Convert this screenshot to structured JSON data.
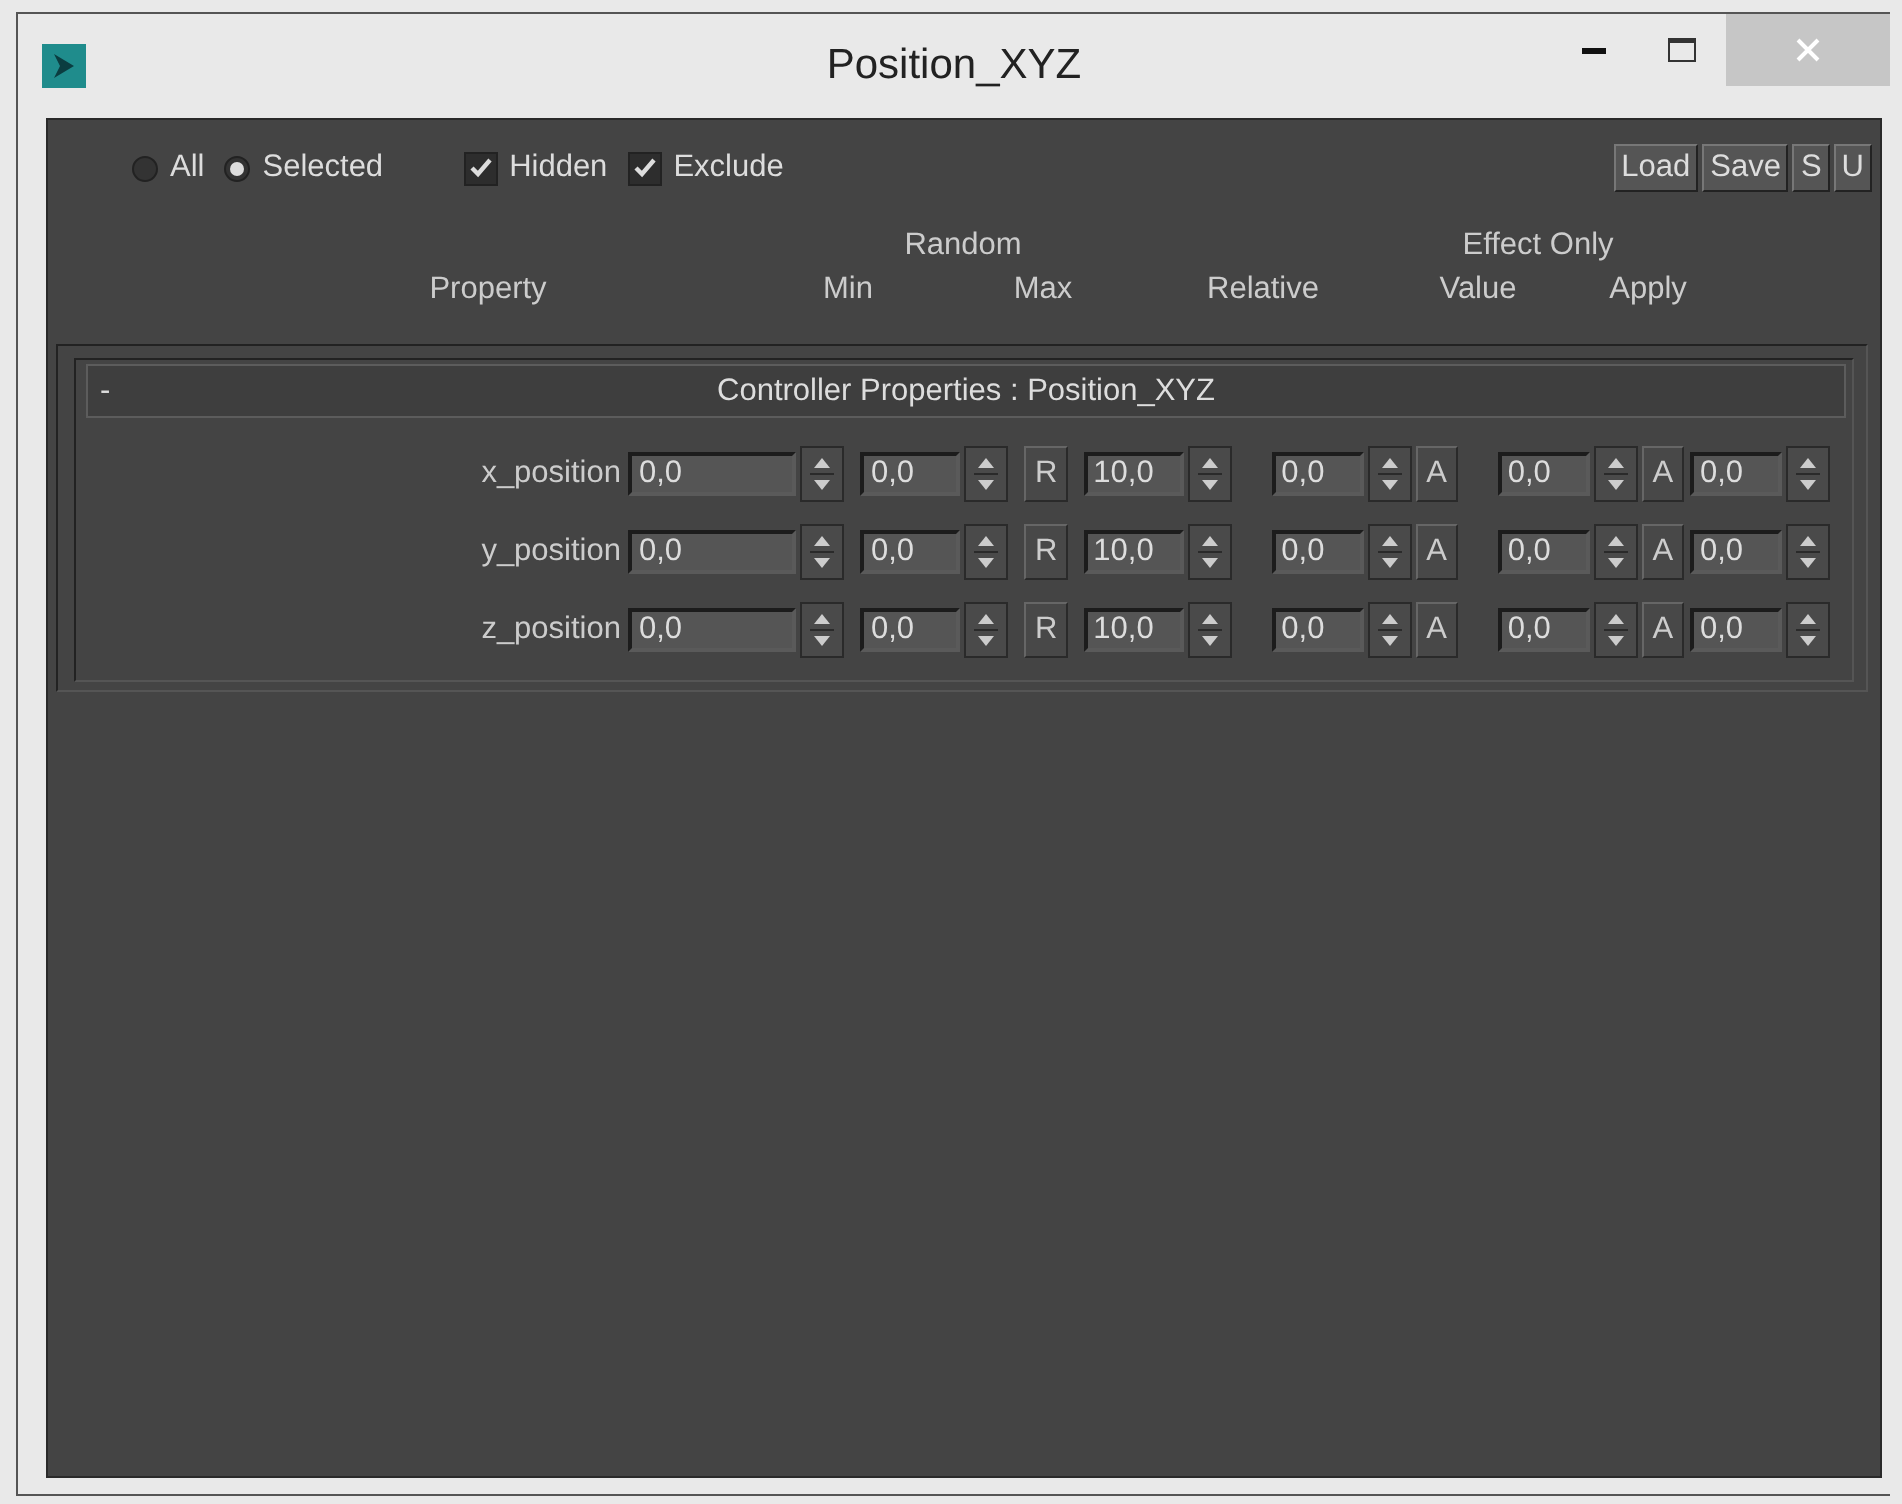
{
  "window": {
    "title": "Position_XYZ"
  },
  "filters": {
    "radios": [
      {
        "label": "All",
        "selected": false
      },
      {
        "label": "Selected",
        "selected": true
      }
    ],
    "checkboxes": [
      {
        "label": "Hidden",
        "checked": true
      },
      {
        "label": "Exclude",
        "checked": true
      }
    ]
  },
  "toolbar_buttons": [
    "Load",
    "Save",
    "S",
    "U"
  ],
  "header": {
    "group_random": "Random",
    "group_effect": "Effect Only",
    "columns": [
      "Property",
      "Min",
      "Max",
      "Relative",
      "Value",
      "Apply"
    ]
  },
  "rollout": {
    "toggle": "-",
    "title": "Controller Properties : Position_XYZ",
    "expanded": true,
    "rows": [
      {
        "label": "x_position",
        "value": "0,0",
        "min": "0,0",
        "random_button": "R",
        "max": "10,0",
        "relative": "0,0",
        "relative_button": "A",
        "effect_value": "0,0",
        "effect_button": "A",
        "apply": "0,0"
      },
      {
        "label": "y_position",
        "value": "0,0",
        "min": "0,0",
        "random_button": "R",
        "max": "10,0",
        "relative": "0,0",
        "relative_button": "A",
        "effect_value": "0,0",
        "effect_button": "A",
        "apply": "0,0"
      },
      {
        "label": "z_position",
        "value": "0,0",
        "min": "0,0",
        "random_button": "R",
        "max": "10,0",
        "relative": "0,0",
        "relative_button": "A",
        "effect_value": "0,0",
        "effect_button": "A",
        "apply": "0,0"
      }
    ]
  }
}
